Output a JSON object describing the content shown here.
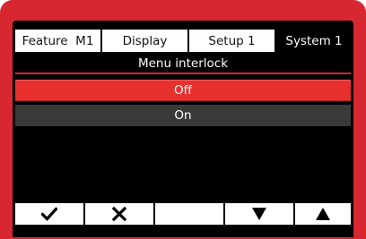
{
  "tabs": [
    {
      "label": "Feature  M1",
      "active": false
    },
    {
      "label": "Display",
      "active": false
    },
    {
      "label": "Setup 1",
      "active": false
    },
    {
      "label": "System 1",
      "active": true
    }
  ],
  "menu": {
    "title": "Menu interlock",
    "options": [
      {
        "label": "Off",
        "selected": true
      },
      {
        "label": "On",
        "selected": false
      }
    ]
  },
  "softkeys": [
    {
      "icon": "check-icon"
    },
    {
      "icon": "cross-icon"
    },
    {
      "icon": ""
    },
    {
      "icon": "arrow-down-icon"
    },
    {
      "icon": "arrow-up-icon"
    }
  ],
  "colors": {
    "bezel": "#d72730",
    "selected": "#e8302f",
    "unselected": "#3a3a3a",
    "screen": "#000000"
  }
}
